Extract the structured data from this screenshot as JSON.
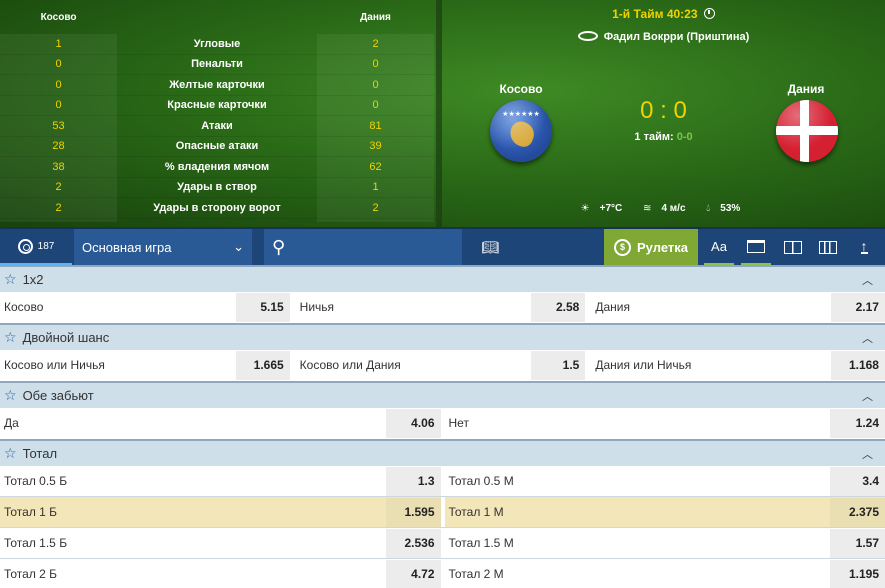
{
  "stats": {
    "team1": "Косово",
    "team2": "Дания",
    "rows": [
      {
        "v1": "1",
        "label": "Угловые",
        "v2": "2"
      },
      {
        "v1": "0",
        "label": "Пенальти",
        "v2": "0"
      },
      {
        "v1": "0",
        "label": "Желтые карточки",
        "v2": "0"
      },
      {
        "v1": "0",
        "label": "Красные карточки",
        "v2": "0"
      },
      {
        "v1": "53",
        "label": "Атаки",
        "v2": "81"
      },
      {
        "v1": "28",
        "label": "Опасные атаки",
        "v2": "39"
      },
      {
        "v1": "38",
        "label": "% владения мячом",
        "v2": "62"
      },
      {
        "v1": "2",
        "label": "Удары в створ",
        "v2": "1"
      },
      {
        "v1": "2",
        "label": "Удары в сторону ворот",
        "v2": "2"
      }
    ]
  },
  "match": {
    "period": "1-й Тайм",
    "time": "40:23",
    "stadium": "Фадил Вокрри (Приштина)",
    "home": "Косово",
    "away": "Дания",
    "score": "0 : 0",
    "half_label": "1 тайм:",
    "half_score": "0-0",
    "temp": "+7°C",
    "wind": "4 м/с",
    "humidity": "53%"
  },
  "toolbar": {
    "count": "187",
    "select_value": "Основная игра",
    "roulette": "Рулетка",
    "font_label": "Aa"
  },
  "markets": {
    "m1x2": {
      "title": "1x2",
      "o1": {
        "name": "Косово",
        "odd": "5.15"
      },
      "o2": {
        "name": "Ничья",
        "odd": "2.58"
      },
      "o3": {
        "name": "Дания",
        "odd": "2.17"
      }
    },
    "double": {
      "title": "Двойной шанс",
      "o1": {
        "name": "Косово или Ничья",
        "odd": "1.665"
      },
      "o2": {
        "name": "Косово или Дания",
        "odd": "1.5"
      },
      "o3": {
        "name": "Дания или Ничья",
        "odd": "1.168"
      }
    },
    "both": {
      "title": "Обе забьют",
      "o1": {
        "name": "Да",
        "odd": "4.06"
      },
      "o2": {
        "name": "Нет",
        "odd": "1.24"
      }
    },
    "total": {
      "title": "Тотал",
      "rows": [
        {
          "over": "Тотал 0.5 Б",
          "over_odd": "1.3",
          "under": "Тотал 0.5 М",
          "under_odd": "3.4"
        },
        {
          "over": "Тотал 1 Б",
          "over_odd": "1.595",
          "under": "Тотал 1 М",
          "under_odd": "2.375"
        },
        {
          "over": "Тотал 1.5 Б",
          "over_odd": "2.536",
          "under": "Тотал 1.5 М",
          "under_odd": "1.57"
        },
        {
          "over": "Тотал 2 Б",
          "over_odd": "4.72",
          "under": "Тотал 2 М",
          "under_odd": "1.195"
        }
      ]
    }
  },
  "colors": {
    "accent_yellow": "#f1d200",
    "toolbar_blue": "#1e4577",
    "roulette_green": "#7fa934",
    "market_header": "#cfdfe9",
    "highlight_row": "#f3e6b8"
  }
}
